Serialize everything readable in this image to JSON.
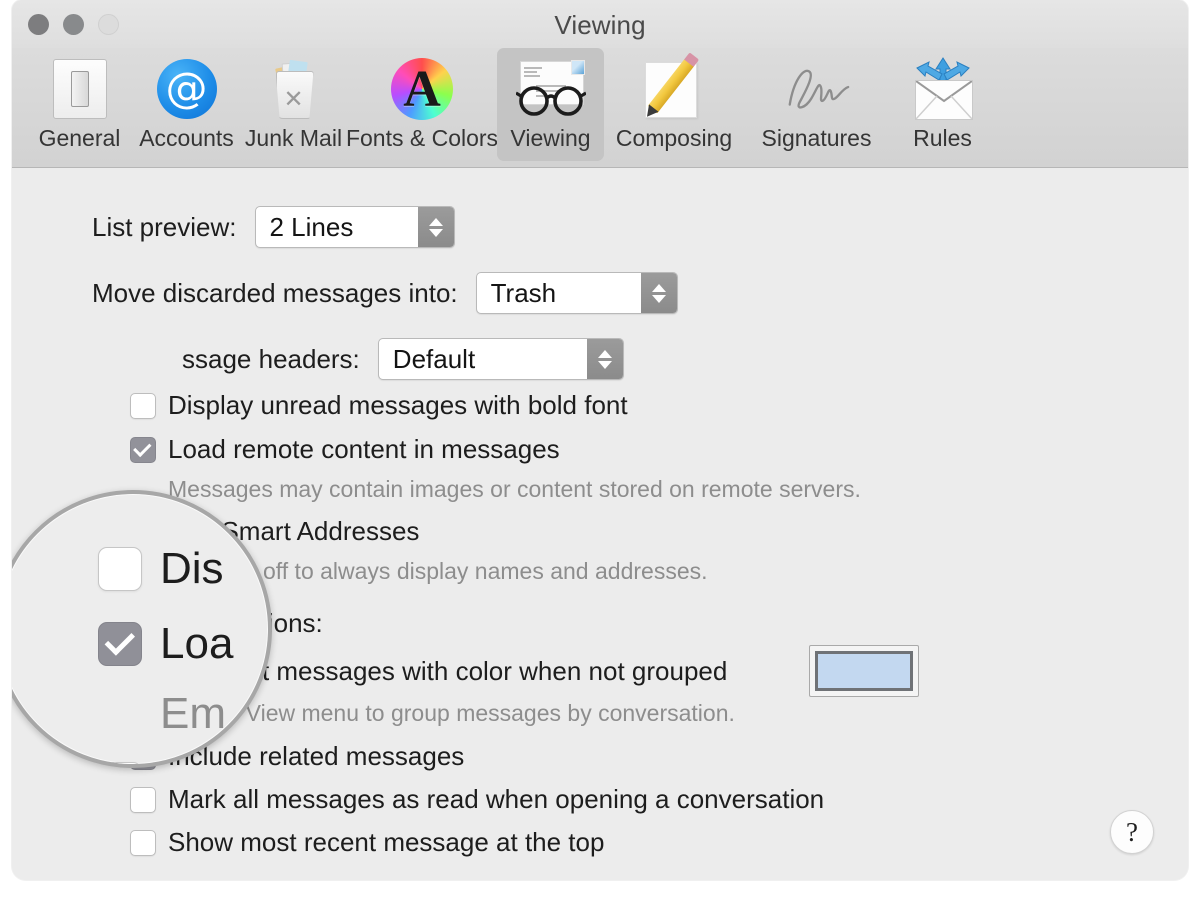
{
  "window": {
    "title": "Viewing",
    "traffic_lights": [
      "close",
      "minimize",
      "zoom"
    ]
  },
  "toolbar": {
    "items": [
      {
        "label": "General",
        "icon": "switch-icon",
        "selected": false
      },
      {
        "label": "Accounts",
        "icon": "at-sign-icon",
        "selected": false
      },
      {
        "label": "Junk Mail",
        "icon": "trash-can-icon",
        "selected": false
      },
      {
        "label": "Fonts & Colors",
        "icon": "color-wheel-a-icon",
        "selected": false
      },
      {
        "label": "Viewing",
        "icon": "glasses-icon",
        "selected": true
      },
      {
        "label": "Composing",
        "icon": "pencil-paper-icon",
        "selected": false
      },
      {
        "label": "Signatures",
        "icon": "signature-icon",
        "selected": false
      },
      {
        "label": "Rules",
        "icon": "envelope-arrows-icon",
        "selected": false
      }
    ]
  },
  "settings": {
    "list_preview": {
      "label": "List preview:",
      "value": "2 Lines"
    },
    "move_discarded": {
      "label": "Move discarded messages into:",
      "value": "Trash"
    },
    "message_headers": {
      "label": "ssage headers:",
      "full_label": "Show message headers:",
      "value": "Default"
    },
    "checkboxes": [
      {
        "label": "Display unread messages with bold font",
        "visible_label": "unread messages with bold font",
        "checked": false
      },
      {
        "label": "Load remote content in messages",
        "visible_label": "mote content in messages",
        "checked": true,
        "hint": "essages may contain images or content stored on remote servers.",
        "hint_full": "Messages may contain images or content stored on remote servers."
      },
      {
        "label": "Use Smart Addresses",
        "visible_label": "mart Addresses",
        "checked": false,
        "hint": "rn this off to always display names and addresses.",
        "hint_full": "Turn this off to always display names and addresses."
      }
    ]
  },
  "conversations": {
    "section_label": "View conversations:",
    "items": [
      {
        "label": "Highlight messages with color when not grouped",
        "checked": true,
        "hint": "Use the View menu to group messages by conversation.",
        "color_swatch": "#c3d8f0"
      },
      {
        "label": "Include related messages",
        "checked": true
      },
      {
        "label": "Mark all messages as read when opening a conversation",
        "checked": false
      },
      {
        "label": "Show most recent message at the top",
        "checked": false
      }
    ]
  },
  "loupe": {
    "magnified_lines": [
      {
        "text": "Dis",
        "checked": false,
        "muted": false
      },
      {
        "text": "Loa",
        "checked": true,
        "muted": false
      },
      {
        "text": "Em",
        "checked": null,
        "muted": true
      }
    ]
  },
  "help": {
    "label": "?"
  }
}
